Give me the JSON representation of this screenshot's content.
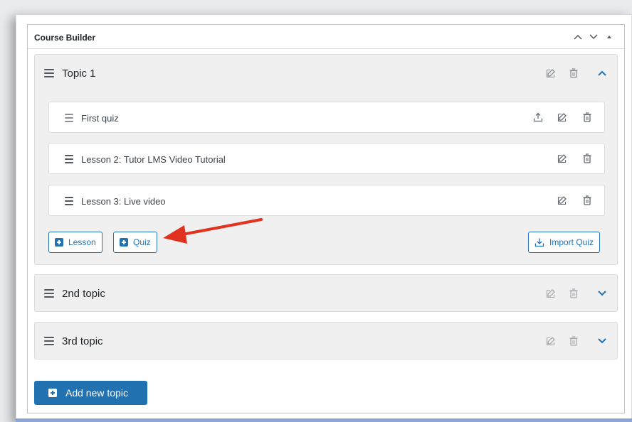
{
  "panel": {
    "title": "Course Builder",
    "move_up_icon": "chevron-up-icon",
    "move_down_icon": "chevron-down-icon",
    "toggle_icon": "triangle-up-icon"
  },
  "topics": [
    {
      "title": "Topic 1",
      "expanded": true,
      "items": [
        {
          "title": "First quiz",
          "type": "quiz",
          "icons": [
            "upload-icon",
            "edit-icon",
            "trash-icon"
          ]
        },
        {
          "title": "Lesson 2: Tutor LMS Video Tutorial",
          "type": "lesson",
          "icons": [
            "edit-icon",
            "trash-icon"
          ]
        },
        {
          "title": "Lesson 3: Live video",
          "type": "lesson",
          "icons": [
            "edit-icon",
            "trash-icon"
          ]
        }
      ],
      "actions": {
        "lesson_label": "Lesson",
        "quiz_label": "Quiz",
        "import_quiz_label": "Import Quiz"
      }
    },
    {
      "title": "2nd topic",
      "expanded": false
    },
    {
      "title": "3rd topic",
      "expanded": false
    }
  ],
  "add_topic_label": "Add new topic",
  "colors": {
    "accent": "#2271b1",
    "annotation_arrow": "#e0321e",
    "topic_bg": "#f0f0f1"
  }
}
